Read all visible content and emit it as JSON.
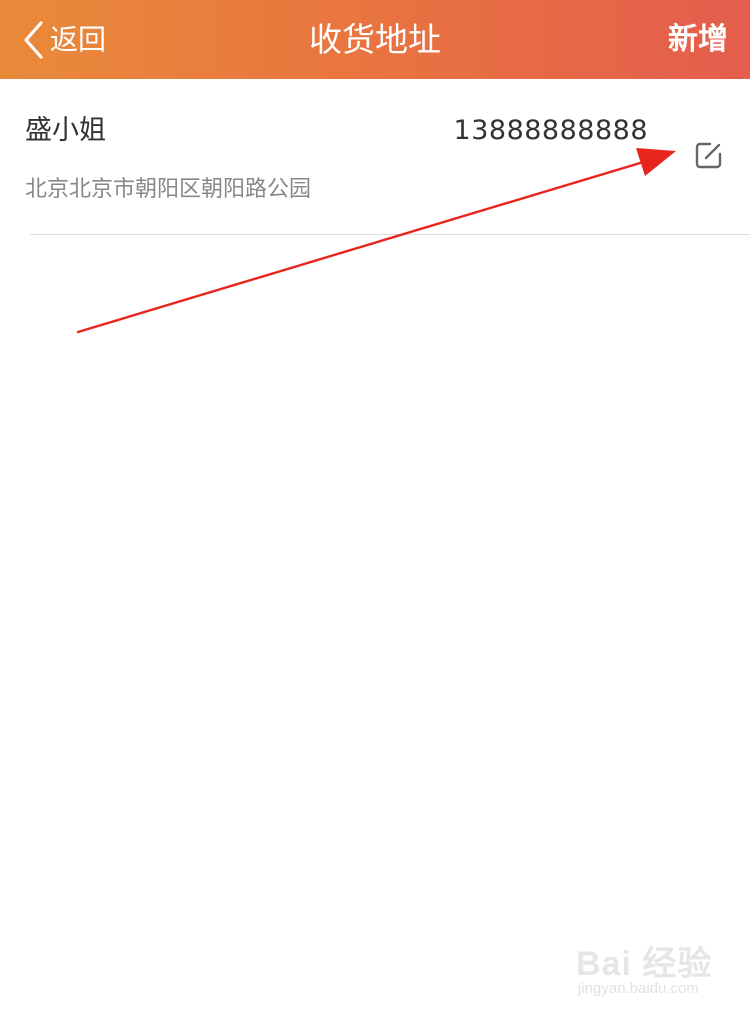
{
  "nav": {
    "back_label": "返回",
    "title": "收货地址",
    "add_label": "新增"
  },
  "address": {
    "name": "盛小姐",
    "phone": "13888888888",
    "detail": "北京北京市朝阳区朝阳路公园"
  },
  "icons": {
    "back": "chevron-left-icon",
    "edit": "edit-icon"
  },
  "colors": {
    "header_start": "#e98a3a",
    "header_end": "#e45d4d",
    "annotation_arrow": "#e8251c"
  },
  "watermark": {
    "logo": "Bai 经验",
    "sub": "jingyan.baidu.com"
  }
}
